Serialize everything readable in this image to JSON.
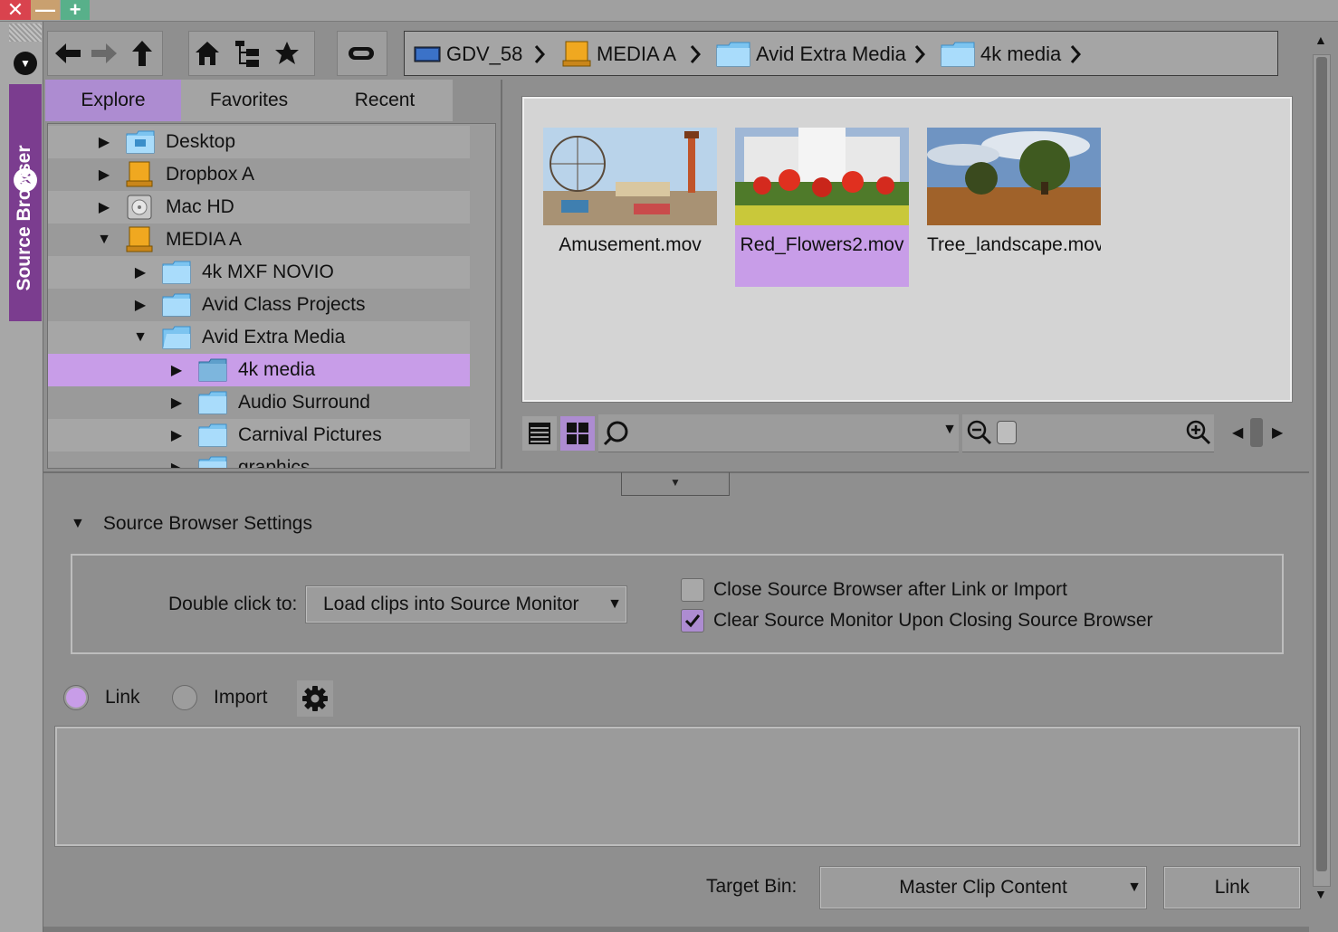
{
  "window": {
    "close_glyph": "✕",
    "minimize_glyph": "—",
    "maximize_glyph": "+"
  },
  "side_tab": {
    "label": "Source Browser",
    "close_glyph": "✕",
    "menu_glyph": "▼",
    "accent_color": "#7b3d8f"
  },
  "toolbar": {
    "buttons": [
      "back-icon",
      "forward-icon",
      "up-icon",
      "home-icon",
      "tree-view-icon",
      "favorite-star-icon",
      "toggle-icon"
    ]
  },
  "path_bar": {
    "crumbs": [
      {
        "label": "GDV_58",
        "icon": "computer-icon"
      },
      {
        "label": "MEDIA A",
        "icon": "drive-icon"
      },
      {
        "label": "Avid Extra Media",
        "icon": "folder-icon"
      },
      {
        "label": "4k media",
        "icon": "folder-icon"
      }
    ]
  },
  "tabs": [
    {
      "label": "Explore",
      "active": true
    },
    {
      "label": "Favorites",
      "active": false
    },
    {
      "label": "Recent",
      "active": false
    }
  ],
  "tree": {
    "items": [
      {
        "label": "Desktop",
        "level": 0,
        "expanded": false,
        "icon": "desktop-folder-icon"
      },
      {
        "label": "Dropbox A",
        "level": 0,
        "expanded": false,
        "icon": "drive-icon"
      },
      {
        "label": "Mac HD",
        "level": 0,
        "expanded": false,
        "icon": "hard-disk-icon"
      },
      {
        "label": "MEDIA A",
        "level": 0,
        "expanded": true,
        "icon": "drive-icon"
      },
      {
        "label": "4k MXF NOVIO",
        "level": 1,
        "expanded": false,
        "icon": "folder-icon"
      },
      {
        "label": "Avid Class Projects",
        "level": 1,
        "expanded": false,
        "icon": "folder-icon"
      },
      {
        "label": "Avid Extra Media",
        "level": 1,
        "expanded": true,
        "icon": "folder-icon"
      },
      {
        "label": "4k media",
        "level": 2,
        "expanded": false,
        "icon": "folder-icon",
        "selected": true
      },
      {
        "label": "Audio Surround",
        "level": 2,
        "expanded": false,
        "icon": "folder-icon"
      },
      {
        "label": "Carnival Pictures",
        "level": 2,
        "expanded": false,
        "icon": "folder-icon"
      },
      {
        "label": "graphics",
        "level": 2,
        "expanded": false,
        "icon": "folder-icon"
      }
    ]
  },
  "thumbnails": [
    {
      "label": "Amusement.mov",
      "selected": false
    },
    {
      "label": "Red_Flowers2.mov",
      "selected": true
    },
    {
      "label": "Tree_landscape.mov",
      "selected": false
    }
  ],
  "view_bar": {
    "search_value": "",
    "view_mode": "grid"
  },
  "settings": {
    "title": "Source Browser Settings",
    "double_click_label": "Double click to:",
    "double_click_value": "Load clips into Source Monitor",
    "close_after_label": "Close Source Browser after Link or Import",
    "close_after_checked": false,
    "clear_monitor_label": "Clear Source Monitor Upon Closing Source Browser",
    "clear_monitor_checked": true
  },
  "mode": {
    "link_label": "Link",
    "import_label": "Import",
    "selected": "Link"
  },
  "footer": {
    "target_bin_label": "Target Bin:",
    "target_bin_value": "Master Clip Content",
    "link_button": "Link"
  },
  "colors": {
    "selection": "#c89de8",
    "active_tab": "#ad8cd1",
    "panel": "#8f8f8f"
  }
}
